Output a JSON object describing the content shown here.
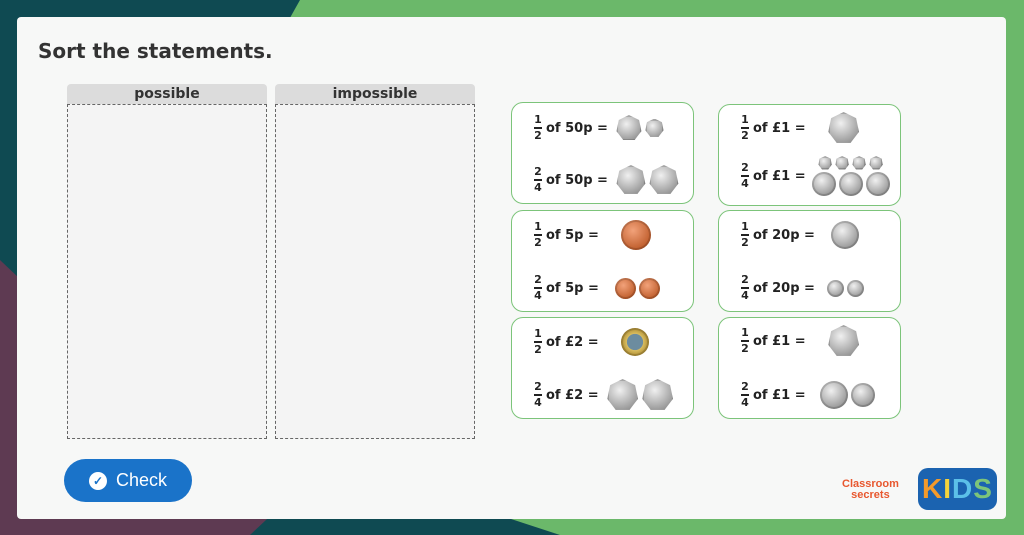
{
  "title": "Sort the statements.",
  "columns": [
    {
      "label": "possible"
    },
    {
      "label": "impossible"
    }
  ],
  "cards": [
    {
      "rows": [
        {
          "num": "1",
          "den": "2",
          "text": "of 50p ="
        },
        {
          "num": "2",
          "den": "4",
          "text": "of 50p ="
        }
      ]
    },
    {
      "rows": [
        {
          "num": "1",
          "den": "2",
          "text": "of £1 ="
        },
        {
          "num": "2",
          "den": "4",
          "text": "of £1 ="
        }
      ]
    },
    {
      "rows": [
        {
          "num": "1",
          "den": "2",
          "text": "of 5p ="
        },
        {
          "num": "2",
          "den": "4",
          "text": "of 5p ="
        }
      ]
    },
    {
      "rows": [
        {
          "num": "1",
          "den": "2",
          "text": "of 20p ="
        },
        {
          "num": "2",
          "den": "4",
          "text": "of 20p ="
        }
      ]
    },
    {
      "rows": [
        {
          "num": "1",
          "den": "2",
          "text": "of £2 ="
        },
        {
          "num": "2",
          "den": "4",
          "text": "of £2 ="
        }
      ]
    },
    {
      "rows": [
        {
          "num": "1",
          "den": "2",
          "text": "of £1 ="
        },
        {
          "num": "2",
          "den": "4",
          "text": "of £1 ="
        }
      ]
    }
  ],
  "check_button": {
    "label": "Check",
    "icon": "check-circle-icon"
  },
  "logos": {
    "classroom_secrets": {
      "line1": "Classroom",
      "line2": "secrets"
    },
    "kids": {
      "letters": [
        "K",
        "I",
        "D",
        "S"
      ],
      "colors": [
        "#f39a2b",
        "#f4d33c",
        "#5cc0e8",
        "#7cc47a"
      ]
    }
  },
  "colors": {
    "accent": "#1a73c9",
    "card_border": "#7cc47a",
    "background_green": "#6bb86a"
  }
}
